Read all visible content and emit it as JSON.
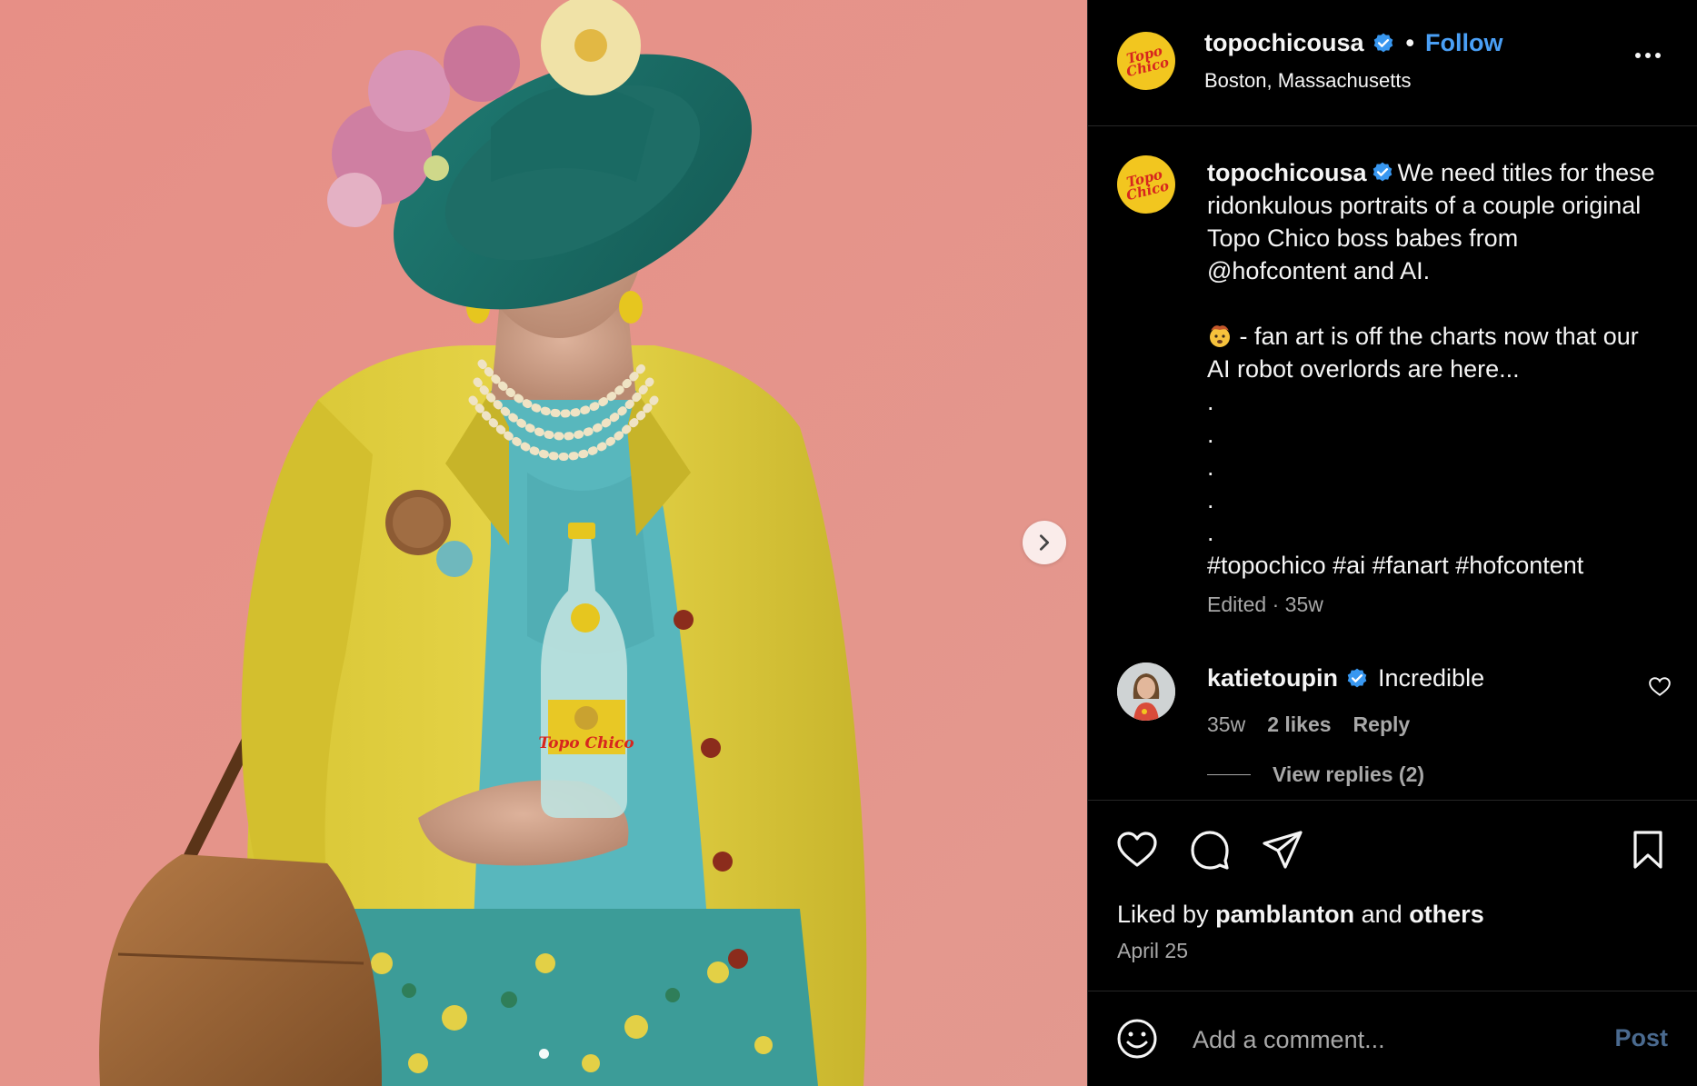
{
  "media": {
    "image_alt": "Portrait of elderly woman in teal hat with flowers, yellow jacket, holding a Topo Chico bottle",
    "bottle_label": "Topo Chico",
    "carousel_dot_count": 1
  },
  "header": {
    "username": "topochicousa",
    "separator": "•",
    "follow_label": "Follow",
    "location": "Boston, Massachusetts",
    "logo_text_line1": "Topo",
    "logo_text_line2": "Chico"
  },
  "caption": {
    "username": "topochicousa",
    "text_1": "We need titles for these ridonkulous portraits of a couple original Topo Chico boss babes from @hofcontent and AI.",
    "text_2": " - fan art is off the charts now that our AI robot overlords are here...",
    "dots": [
      ".",
      ".",
      ".",
      ".",
      "."
    ],
    "hashtags": "#topochico #ai #fanart #hofcontent",
    "meta": "Edited · 35w"
  },
  "comment": {
    "username": "katietoupin",
    "text": "Incredible",
    "time": "35w",
    "likes": "2 likes",
    "reply_label": "Reply",
    "view_replies": "View replies (2)"
  },
  "actions": {
    "liked_by_prefix": "Liked by",
    "liked_by_user": "pamblanton",
    "liked_by_and": "and",
    "liked_by_others": "others",
    "date": "April 25"
  },
  "comment_input": {
    "placeholder": "Add a comment...",
    "post_label": "Post"
  },
  "colors": {
    "accent_blue": "#4a9ff5",
    "verified_blue": "#3897f0",
    "brand_yellow": "#f2c61f",
    "brand_red": "#d7261e",
    "muted_text": "#a8a8a8",
    "background_pink": "#e79a90"
  }
}
